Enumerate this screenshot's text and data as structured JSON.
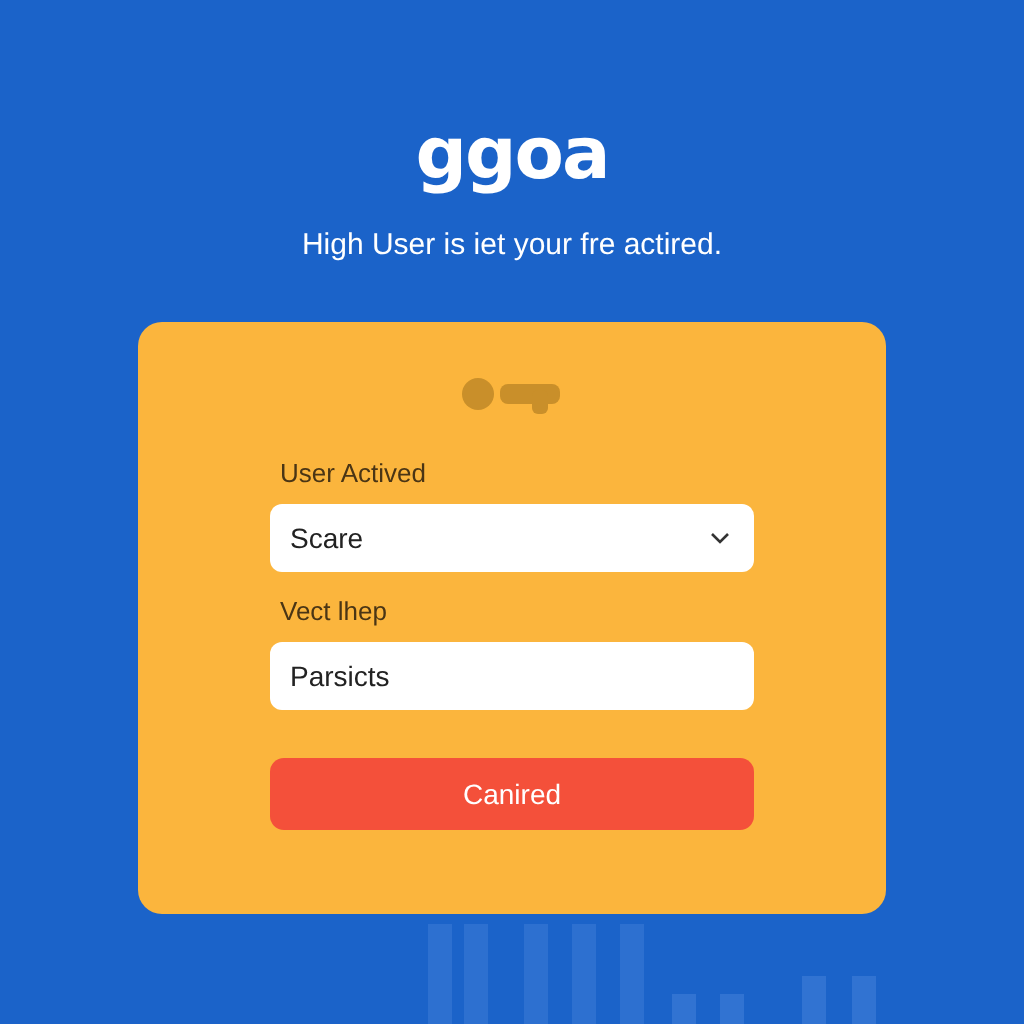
{
  "logo": "ggoa",
  "subtitle": "High User is iet your fre actired.",
  "form": {
    "fields": [
      {
        "kind": "select",
        "label": "User Actived",
        "value": "Scare"
      },
      {
        "kind": "text",
        "label": "Vect lhep",
        "value": "Parsicts"
      }
    ],
    "button": "Canired"
  }
}
